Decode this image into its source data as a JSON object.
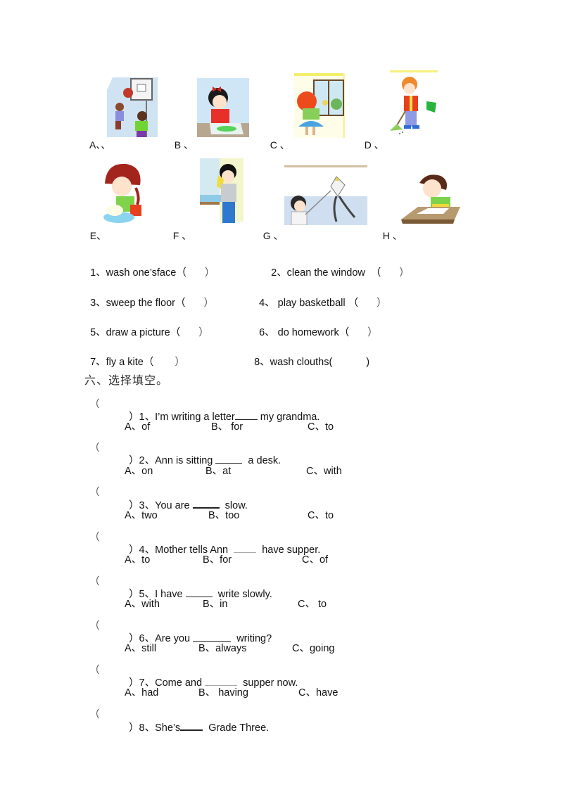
{
  "picture_section": {
    "row1": [
      {
        "letter": "A",
        "sep": "、、",
        "picture": "boys-playing-basketball-image"
      },
      {
        "letter": "B",
        "sep": " 、",
        "picture": "girl-drawing-picture-image"
      },
      {
        "letter": "C",
        "sep": " 、",
        "picture": "girl-cleaning-window-image"
      },
      {
        "letter": "D",
        "sep": " 、",
        "picture": "boy-sweeping-floor-image"
      }
    ],
    "row2": [
      {
        "letter": "E",
        "sep": "、",
        "picture": "girl-washing-clothes-image"
      },
      {
        "letter": "F",
        "sep": " 、",
        "picture": "boy-washing-face-image"
      },
      {
        "letter": "G",
        "sep": " 、",
        "picture": "boy-flying-kite-image"
      },
      {
        "letter": "H",
        "sep": " 、",
        "picture": "boy-doing-homework-image"
      }
    ]
  },
  "matching": [
    {
      "num": "1",
      "text": "1、wash one’sface（",
      "close": "）"
    },
    {
      "num": "2",
      "text": "2、clean the window  （",
      "close": "）"
    },
    {
      "num": "3",
      "text": "3、sweep the floor（",
      "close": "）"
    },
    {
      "num": "4",
      "text": "4、 play basketball （",
      "close": "）"
    },
    {
      "num": "5",
      "text": "5、draw a picture（",
      "close": "）"
    },
    {
      "num": "6",
      "text": "6、 do homework（",
      "close": "）"
    },
    {
      "num": "7",
      "text": "7、fly a kite（",
      "close": "）"
    },
    {
      "num": "8",
      "text": "8、wash clouths(",
      "close": ")"
    }
  ],
  "section_six": {
    "title": "六、选择填空。"
  },
  "questions": [
    {
      "open": "（",
      "before": "）1、I’m writing a letter",
      "after": " my grandma.",
      "options": [
        "A、of",
        "B、 for",
        "C、to"
      ]
    },
    {
      "open": "（",
      "before": "）2、Ann is sitting ",
      "after": "  a desk.",
      "options": [
        "A、on",
        "B、at",
        "C、with"
      ]
    },
    {
      "open": "（",
      "before": "）3、You are ",
      "after": "  slow.",
      "options": [
        "A、two",
        "B、too",
        "C、to"
      ]
    },
    {
      "open": "（",
      "before": "）4、Mother tells Ann  ",
      "after": "  have supper.",
      "options": [
        "A、to",
        "B、for",
        "C、of"
      ]
    },
    {
      "open": "（",
      "before": "）5、I have ",
      "after": "  write slowly.",
      "options": [
        "A、with",
        "B、in",
        "C、 to"
      ]
    },
    {
      "open": "（",
      "before": "）6、Are you ",
      "after": "  writing?",
      "options": [
        "A、still",
        "B、always",
        "C、going"
      ]
    },
    {
      "open": "（",
      "before": "）7、Come and ",
      "after": "  supper now.",
      "options": [
        "A、had",
        "B、 having",
        "C、have"
      ]
    },
    {
      "open": "（",
      "before": "）8、She’s",
      "after": "  Grade Three.",
      "options": []
    }
  ]
}
